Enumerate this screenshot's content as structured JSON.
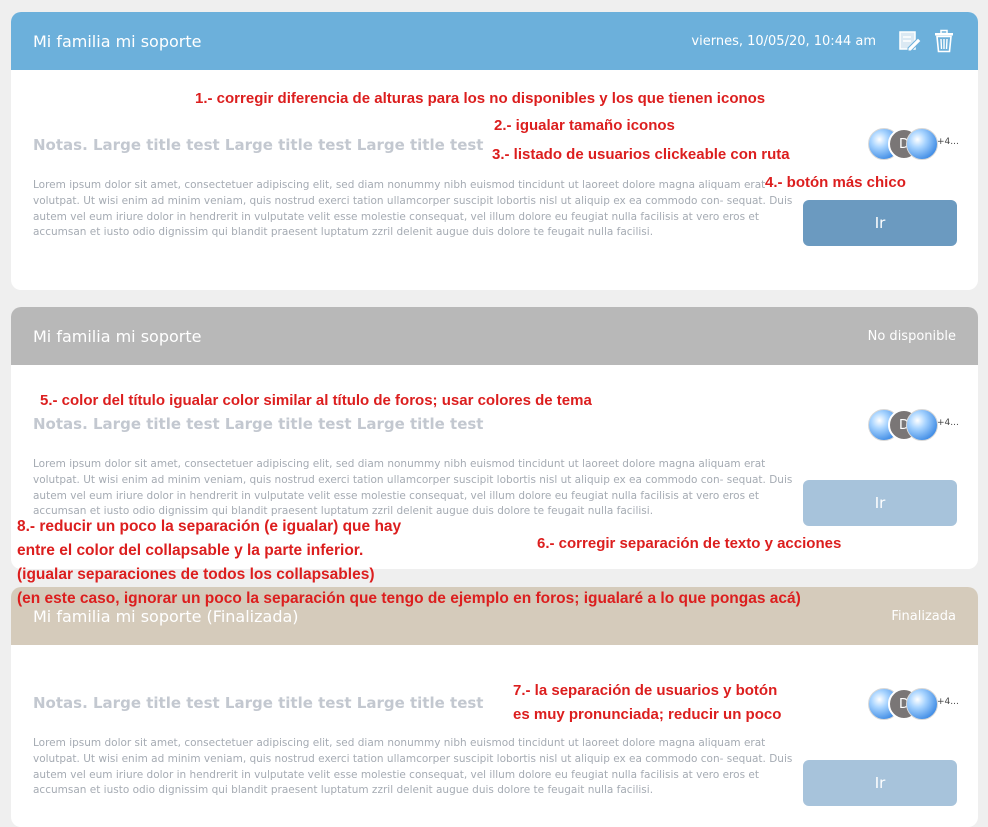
{
  "cards": [
    {
      "title": "Mi familia mi soporte",
      "header_right": "viernes, 10/05/20, 10:44 am",
      "header_color": "#6cb0db",
      "notes_title": "Notas. Large title test Large title test Large title test",
      "body": "Lorem ipsum dolor sit amet, consectetuer adipiscing elit, sed diam nonummy nibh euismod tincidunt ut laoreet dolore magna aliquam erat volutpat. Ut wisi enim ad minim veniam, quis nostrud exerci tation ullamcorper suscipit lobortis nisl ut aliquip ex ea commodo con- sequat. Duis autem vel eum iriure dolor in hendrerit in vulputate velit esse molestie consequat, vel illum dolore eu feugiat nulla facilisis at vero eros et accumsan et iusto odio dignissim qui blandit praesent luptatum zzril delenit augue duis dolore te feugait nulla facilisi.",
      "avatar_letter": "D",
      "avatar_more": "+4...",
      "button_label": "Ir",
      "button_color": "#6b9ac0",
      "icons": [
        "edit-icon",
        "trash-icon"
      ]
    },
    {
      "title": "Mi familia mi soporte",
      "header_right": "No disponible",
      "header_color": "#b8b8b8",
      "notes_title": "Notas. Large title test Large title test Large title test",
      "body": "Lorem ipsum dolor sit amet, consectetuer adipiscing elit, sed diam nonummy nibh euismod tincidunt ut laoreet dolore magna aliquam erat volutpat. Ut wisi enim ad minim veniam, quis nostrud exerci tation ullamcorper suscipit lobortis nisl ut aliquip ex ea commodo con- sequat. Duis autem vel eum iriure dolor in hendrerit in vulputate velit esse molestie consequat, vel illum dolore eu feugiat nulla facilisis at vero eros et accumsan et iusto odio dignissim qui blandit praesent luptatum zzril delenit augue duis dolore te feugait nulla facilisi.",
      "avatar_letter": "D",
      "avatar_more": "+4...",
      "button_label": "Ir",
      "button_color": "#a7c3db"
    },
    {
      "title": "Mi familia mi soporte (Finalizada)",
      "header_right": "Finalizada",
      "header_color": "#d5cbbb",
      "notes_title": "Notas. Large title test Large title test Large title test",
      "body": "Lorem ipsum dolor sit amet, consectetuer adipiscing elit, sed diam nonummy nibh euismod tincidunt ut laoreet dolore magna aliquam erat volutpat. Ut wisi enim ad minim veniam, quis nostrud exerci tation ullamcorper suscipit lobortis nisl ut aliquip ex ea commodo con- sequat. Duis autem vel eum iriure dolor in hendrerit in vulputate velit esse molestie consequat, vel illum dolore eu feugiat nulla facilisis at vero eros et accumsan et iusto odio dignissim qui blandit praesent luptatum zzril delenit augue duis dolore te feugait nulla facilisi.",
      "avatar_letter": "D",
      "avatar_more": "+4...",
      "button_label": "Ir",
      "button_color": "#a7c3db"
    }
  ],
  "annotations": [
    "1.- corregir diferencia de alturas para los no disponibles y los que tienen iconos",
    "2.- igualar tamaño iconos",
    "3.- listado de usuarios clickeable con ruta",
    "4.- botón más chico",
    "5.- color del título igualar  color similar al título de foros; usar colores de tema",
    "6.- corregir separación de texto y acciones",
    "7.- la separación de usuarios y botón",
    "es muy pronunciada; reducir un poco",
    "8.- reducir un poco la separación (e igualar) que hay",
    "entre el color del collapsable y la parte inferior.",
    "(igualar separaciones de todos los collapsables)",
    "(en este caso, ignorar un poco la separación que tengo de ejemplo en foros; igualaré a lo que pongas acá)"
  ],
  "annotation_color": "#dc1e1e"
}
